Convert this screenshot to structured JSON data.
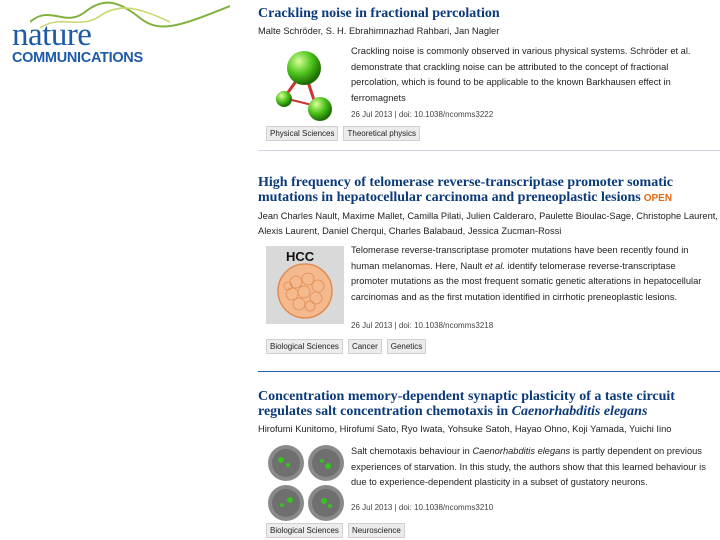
{
  "brand": {
    "line1": "nature",
    "line2": "COMMUNICATIONS"
  },
  "articles": [
    {
      "title": "Crackling noise in fractional percolation",
      "authors": "Malte Schröder, S. H. Ebrahimnazhad Rahbari, Jan Nagler",
      "abstract": "Crackling noise is commonly observed in various physical systems. Schröder et al. demonstrate that crackling noise can be attributed to the concept of fractional percolation, which is found to be applicable to the known Barkhausen effect in ferromagnets",
      "meta": "26 Jul 2013 | doi: 10.1038/ncomms3222",
      "tags": [
        "Physical Sciences",
        "Theoretical physics"
      ]
    },
    {
      "title": "High frequency of telomerase reverse-transcriptase promoter somatic mutations in hepatocellular carcinoma and preneoplastic lesions",
      "open_badge": "OPEN",
      "authors": "Jean Charles Nault, Maxime Mallet, Camilla Pilati, Julien Calderaro, Paulette Bioulac-Sage, Christophe Laurent, Alexis Laurent, Daniel Cherqui, Charles Balabaud, Jessica Zucman-Rossi",
      "thumb_label": "HCC",
      "abstract_pre": "Telomerase reverse-transcriptase promoter mutations have been recently found in human melanomas. Here, Nault ",
      "abstract_em": "et al.",
      "abstract_post": " identify telomerase reverse-transcriptase promoter mutations as the most frequent somatic genetic alterations in hepatocellular carcinomas and as the first mutation identified in cirrhotic preneoplastic lesions.",
      "meta": "26 Jul 2013 | doi: 10.1038/ncomms3218",
      "tags": [
        "Biological Sciences",
        "Cancer",
        "Genetics"
      ]
    },
    {
      "title_pre": "Concentration memory-dependent synaptic plasticity of a taste circuit regulates salt concentration chemotaxis in ",
      "title_em": "Caenorhabditis elegans",
      "authors": "Hirofumi Kunitomo, Hirofumi Sato, Ryo Iwata, Yohsuke Satoh, Hayao Ohno, Koji Yamada, Yuichi Iino",
      "abstract_pre": "Salt chemotaxis behaviour in ",
      "abstract_em": "Caenorhabditis elegans",
      "abstract_post": " is partly dependent on previous experiences of starvation. In this study, the authors show that this learned behaviour is due to experience-dependent plasticity in a subset of gustatory neurons.",
      "meta": "26 Jul 2013 | doi: 10.1038/ncomms3210",
      "tags": [
        "Biological Sciences",
        "Neuroscience"
      ]
    }
  ]
}
